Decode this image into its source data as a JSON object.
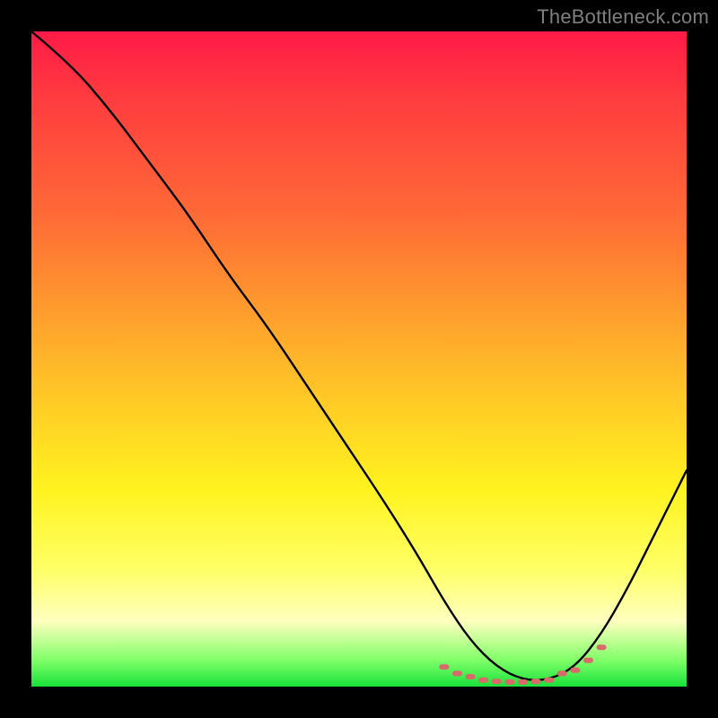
{
  "watermark": "TheBottleneck.com",
  "chart_data": {
    "type": "line",
    "title": "",
    "xlabel": "",
    "ylabel": "",
    "xlim": [
      0,
      100
    ],
    "ylim": [
      0,
      100
    ],
    "grid": false,
    "series": [
      {
        "name": "bottleneck-curve",
        "color": "#000000",
        "x": [
          0,
          6,
          12,
          18,
          24,
          30,
          36,
          42,
          48,
          54,
          59,
          63,
          67,
          71,
          75,
          79,
          83,
          87,
          91,
          95,
          100
        ],
        "values": [
          100,
          95,
          88,
          80,
          72,
          63,
          55,
          46,
          37,
          28,
          20,
          13,
          7,
          3,
          1,
          1,
          3,
          8,
          15,
          23,
          33
        ]
      },
      {
        "name": "optimal-band-markers",
        "color": "#d86a6a",
        "x": [
          63,
          65,
          67,
          69,
          71,
          73,
          75,
          77,
          79,
          81,
          83,
          85,
          87
        ],
        "values": [
          3,
          2,
          1.5,
          1,
          0.8,
          0.7,
          0.7,
          0.8,
          1,
          2,
          2.5,
          4,
          6
        ]
      }
    ],
    "annotations": []
  }
}
